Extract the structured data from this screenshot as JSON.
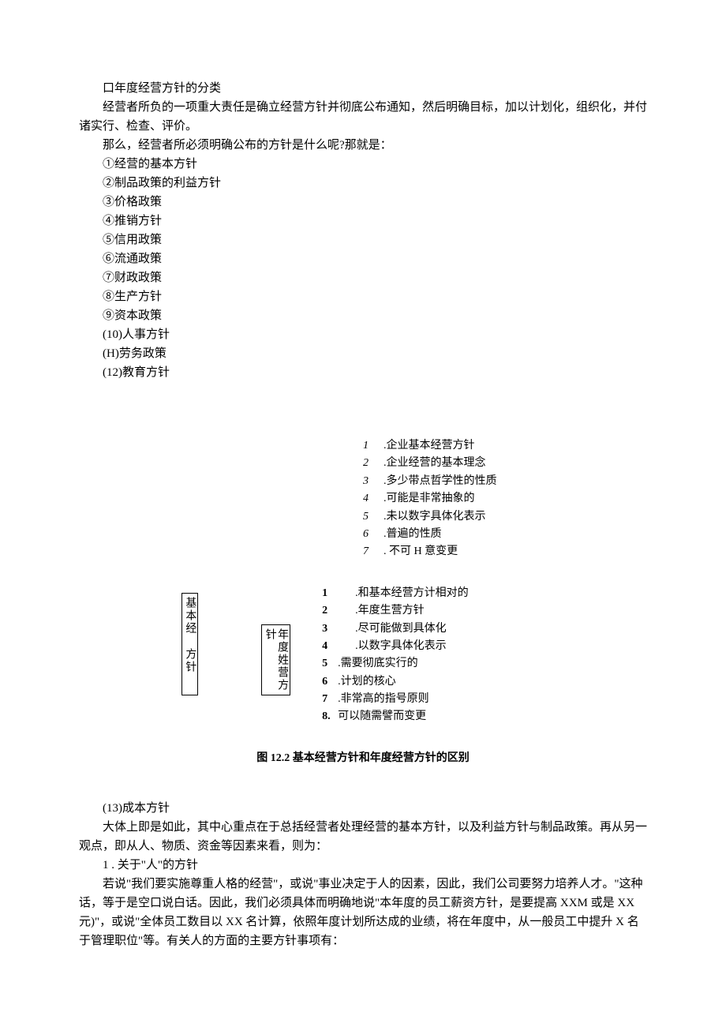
{
  "header": {
    "title": "口年度经营方针的分类",
    "para1": "经营者所负的一项重大责任是确立经营方针并彻底公布通知，然后明确目标，加以计划化，组织化，并付诸实行、检查、评价。",
    "para2": "那么，经营者所必须明确公布的方针是什么呢?那就是："
  },
  "policies": [
    "①经营的基本方针",
    "②制品政策的利益方针",
    "③价格政策",
    "④推销方针",
    "⑤信用政策",
    "⑥流通政策",
    "⑦财政政策",
    "⑧生产方针",
    "⑨资本政策",
    "(10)人事方针",
    "(H)劳务政策",
    "(12)教育方针"
  ],
  "diagram": {
    "leftBoxLine1": "基本经",
    "leftBoxLine2": "方针",
    "midBox": "年度姓营方针",
    "basicFeatures": [
      {
        "n": "1",
        "t": ".企业基本经营方针"
      },
      {
        "n": "2",
        "t": ".企业经营的基本理念"
      },
      {
        "n": "3",
        "t": ".多少带点哲学性的性质"
      },
      {
        "n": "4",
        "t": ".可能是非常抽象的"
      },
      {
        "n": "5",
        "t": ".未以数字具体化表示"
      },
      {
        "n": "6",
        "t": ".普遍的性质"
      },
      {
        "n": "7",
        "t": ". 不可 H 意变更"
      }
    ],
    "annualFeatures": [
      {
        "n": "1",
        "t": ".和基本经营方计相对的"
      },
      {
        "n": "2",
        "t": ".年度生营方针"
      },
      {
        "n": "3",
        "t": ".尽可能做到具体化"
      },
      {
        "n": "4",
        "t": ".以数字具体化表示"
      },
      {
        "n": "5",
        "t": ".需要彻底实行的"
      },
      {
        "n": "6",
        "t": ".计划的核心"
      },
      {
        "n": "7",
        "t": ".非常高的指号原则"
      },
      {
        "n": "8.",
        "t": "可以随需譬而变更"
      }
    ],
    "caption": "图 12.2 基本经营方针和年度经营方针的区别"
  },
  "footer": {
    "item13": "(13)成本方针",
    "para1": "大体上即是如此，其中心重点在于总括经营者处理经营的基本方针，以及利益方针与制品政策。再从另一观点，即从人、物质、资金等因素来看，则为：",
    "sub1": "1 . 关于\"人\"的方针",
    "para2": "若说\"我们要实施尊重人格的经营\"，或说\"事业决定于人的因素，因此，我们公司要努力培养人才。\"这种话，等于是空口说白话。因此，我们必须具体而明确地说\"本年度的员工薪资方针，是要提高 XXM 或是 XX 元)\"，或说\"全体员工数目以 XX 名计算，依照年度计划所达成的业绩，将在年度中，从一般员工中提升 X 名于管理职位\"等。有关人的方面的主要方针事项有："
  }
}
